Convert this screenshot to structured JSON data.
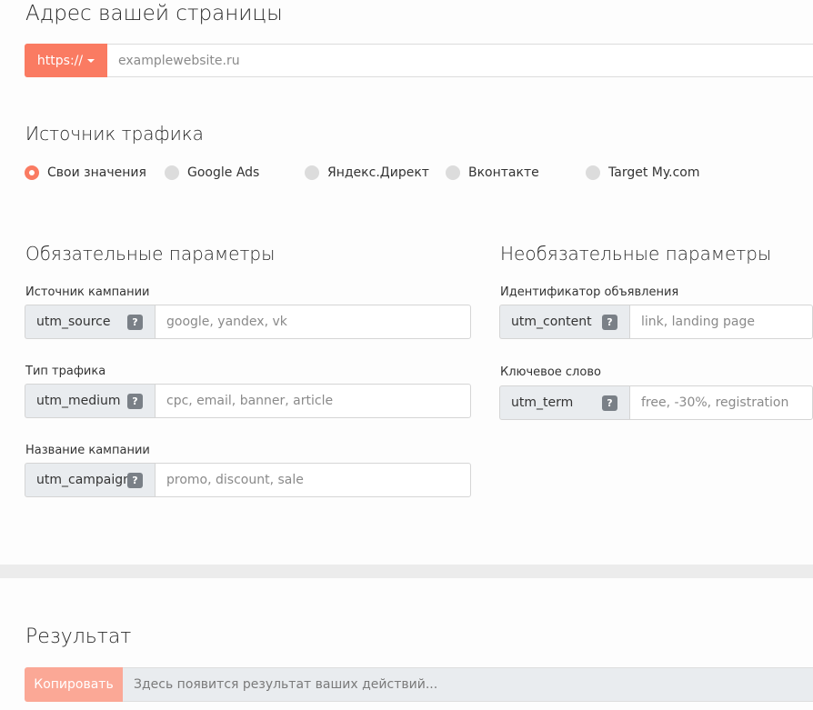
{
  "address": {
    "title": "Адрес вашей страницы",
    "protocol_label": "https://",
    "url_placeholder": "examplewebsite.ru",
    "url_value": ""
  },
  "traffic_source": {
    "title": "Источник трафика",
    "options": [
      {
        "label": "Свои значения",
        "selected": true
      },
      {
        "label": "Google Ads",
        "selected": false
      },
      {
        "label": "Яндекс.Директ",
        "selected": false
      },
      {
        "label": "Вконтакте",
        "selected": false
      },
      {
        "label": "Target My.com",
        "selected": false
      }
    ]
  },
  "required": {
    "title": "Обязательные параметры",
    "fields": [
      {
        "label": "Источник кампании",
        "param": "utm_source",
        "placeholder": "google, yandex, vk",
        "value": "",
        "help": "?"
      },
      {
        "label": "Тип трафика",
        "param": "utm_medium",
        "placeholder": "cpc, email, banner, article",
        "value": "",
        "help": "?"
      },
      {
        "label": "Название кампании",
        "param": "utm_campaign",
        "placeholder": "promo, discount, sale",
        "value": "",
        "help": "?"
      }
    ]
  },
  "optional": {
    "title": "Необязательные параметры",
    "fields": [
      {
        "label": "Идентификатор объявления",
        "param": "utm_content",
        "placeholder": "link, landing page",
        "value": "",
        "help": "?"
      },
      {
        "label": "Ключевое слово",
        "param": "utm_term",
        "placeholder": "free, -30%, registration",
        "value": "",
        "help": "?"
      }
    ]
  },
  "result": {
    "title": "Результат",
    "copy_label": "Копировать",
    "placeholder": "Здесь появится результат ваших действий..."
  },
  "colors": {
    "accent": "#fa7b62",
    "accent_light": "#fba896",
    "addon_bg": "#e9ecef",
    "help_bg": "#7a8087"
  }
}
